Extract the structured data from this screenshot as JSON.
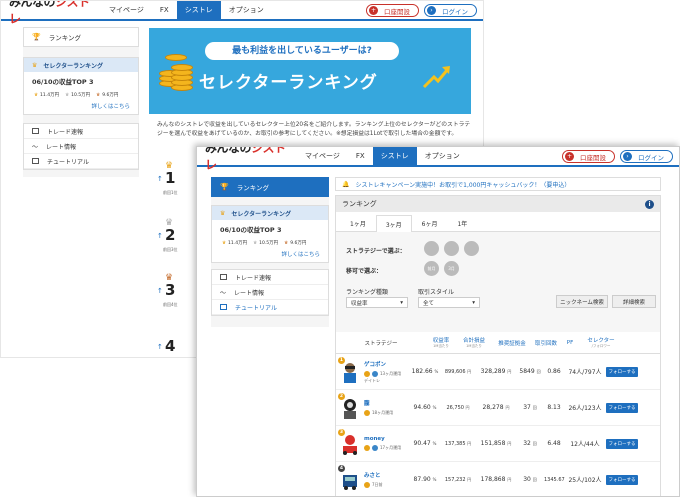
{
  "header": {
    "logo_prefix": "みんなの",
    "logo_brand": "シストレ",
    "nav": [
      "マイページ",
      "FX",
      "シストレ",
      "オプション"
    ],
    "open_account": "口座開設",
    "login": "ログイン"
  },
  "sidebar": {
    "ranking": "ランキング",
    "selector_ranking": "セレクターランキング",
    "top3_title": "06/10の収益TOP 3",
    "stats": [
      "11.4万円",
      "10.5万円",
      "9.6万円"
    ],
    "details_link": "詳しくはこちら",
    "menu": [
      "トレード速報",
      "レート情報",
      "チュートリアル"
    ]
  },
  "banner": {
    "question": "最も利益を出しているユーザーは?",
    "title": "セレクターランキング"
  },
  "description": "みんなのシストレで収益を出しているセレクター上位20名をご紹介します。ランキング上位のセレクターがどのストラテジーを選んで収益をあげているのか、お取引の参考にしてください。※想定損益は1Lotで取引した場合の金額です。",
  "back_ranks": [
    {
      "num": "1",
      "sub": "前回1位"
    },
    {
      "num": "2",
      "sub": "前回3位"
    },
    {
      "num": "3",
      "sub": "前回4位"
    },
    {
      "num": "4",
      "sub": ""
    }
  ],
  "campaign": "シストレキャンペーン実施中！お取引で1,000円キャッシュバック！（要申込）",
  "panel": {
    "title": "ランキング",
    "info": "i",
    "tabs": [
      "1ヶ月",
      "3ヶ月",
      "6ヶ月",
      "1年"
    ],
    "active_tab": "3ヶ月",
    "filter_strategy": "ストラテジーで選ぶ：",
    "filter_period": "移可で選ぶ：",
    "period_icons": [
      "前月",
      "3月"
    ],
    "rank_type_label": "ランキング種類",
    "rank_type_value": "収益率",
    "style_label": "取引スタイル",
    "style_value": "全て",
    "nickname_search": "ニックネーム検索",
    "detail_search": "詳細検索"
  },
  "table": {
    "headers": [
      {
        "label": "ストラテジー",
        "sub": ""
      },
      {
        "label": "収益率",
        "sub": "1M当たり"
      },
      {
        "label": "合計損益",
        "sub": "1M当たり"
      },
      {
        "label": "推奨証拠金",
        "sub": ""
      },
      {
        "label": "取引回数",
        "sub": ""
      },
      {
        "label": "PF",
        "sub": ""
      },
      {
        "label": "セレクター",
        "sub": "/フォロワー"
      }
    ],
    "rows": [
      {
        "rank": "1",
        "name": "ゲコポン",
        "period": "13ヶ月運用",
        "sub": "デイトレ",
        "return": "182.66",
        "pnl": "899,606",
        "margin": "328,289",
        "trades": "5849",
        "pf": "0.86",
        "followers": "74人/797人"
      },
      {
        "rank": "2",
        "name": "朧",
        "period": "18ヶ月運用",
        "sub": "",
        "return": "94.60",
        "pnl": "26,750",
        "margin": "28,278",
        "trades": "37",
        "pf": "8.13",
        "followers": "26人/123人"
      },
      {
        "rank": "3",
        "name": "money",
        "period": "17ヶ月運用",
        "sub": "",
        "return": "90.47",
        "pnl": "137,385",
        "margin": "151,858",
        "trades": "32",
        "pf": "6.48",
        "followers": "12人/44人"
      },
      {
        "rank": "4",
        "name": "みさと",
        "period": "7日前",
        "sub": "",
        "return": "87.90",
        "pnl": "157,232",
        "margin": "178,868",
        "trades": "30",
        "pf": "1345.67",
        "followers": "25人/102人"
      }
    ],
    "follow_label": "フォローする",
    "units": {
      "percent": "%",
      "yen": "円",
      "times": "回"
    }
  },
  "colors": {
    "brand_blue": "#1e6fbf",
    "brand_red": "#c8322b",
    "banner": "#36a7dd",
    "gold": "#e8a317"
  }
}
